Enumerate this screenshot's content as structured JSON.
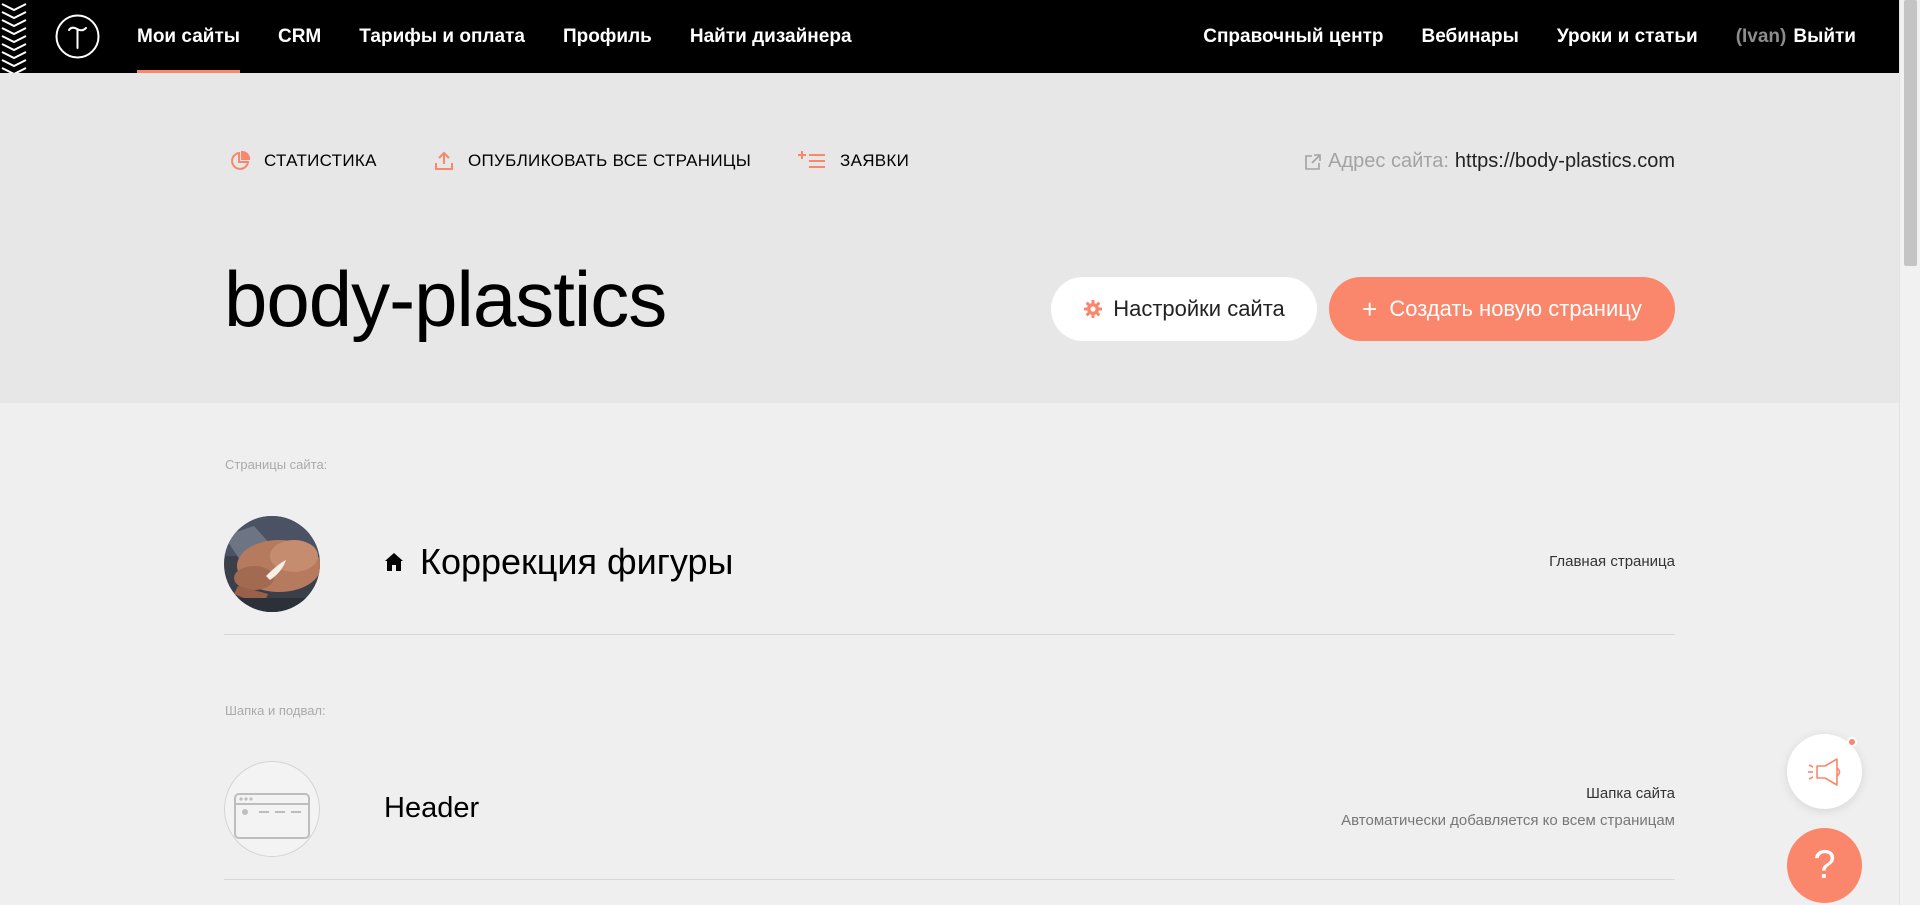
{
  "nav": {
    "left": [
      {
        "label": "Мои сайты",
        "active": true
      },
      {
        "label": "CRM"
      },
      {
        "label": "Тарифы и оплата"
      },
      {
        "label": "Профиль"
      },
      {
        "label": "Найти дизайнера"
      }
    ],
    "right": {
      "help_center": "Справочный центр",
      "webinars": "Вебинары",
      "lessons": "Уроки и статьи",
      "user": "(Ivan)",
      "logout": "Выйти"
    }
  },
  "actions": {
    "stats": "СТАТИСТИКА",
    "publish_all": "ОПУБЛИКОВАТЬ ВСЕ СТРАНИЦЫ",
    "requests": "ЗАЯВКИ"
  },
  "site": {
    "address_label": "Адрес сайта:",
    "address_url": "https://body-plastics.com",
    "title": "body-plastics",
    "settings_button": "Настройки сайта",
    "create_button": "Создать новую страницу",
    "create_plus": "+"
  },
  "sections": {
    "pages_label": "Страницы сайта:",
    "header_footer_label": "Шапка и подвал:"
  },
  "pages": [
    {
      "title": "Коррекция фигуры",
      "meta": "Главная страница",
      "home": true
    }
  ],
  "header_row": {
    "title": "Header",
    "meta1": "Шапка сайта",
    "meta2": "Автоматически добавляется ко всем страницам"
  },
  "help_fab": "?",
  "colors": {
    "accent": "#fa876b",
    "topbar": "#000000",
    "hero": "#e7e7e7",
    "content": "#efefef"
  }
}
